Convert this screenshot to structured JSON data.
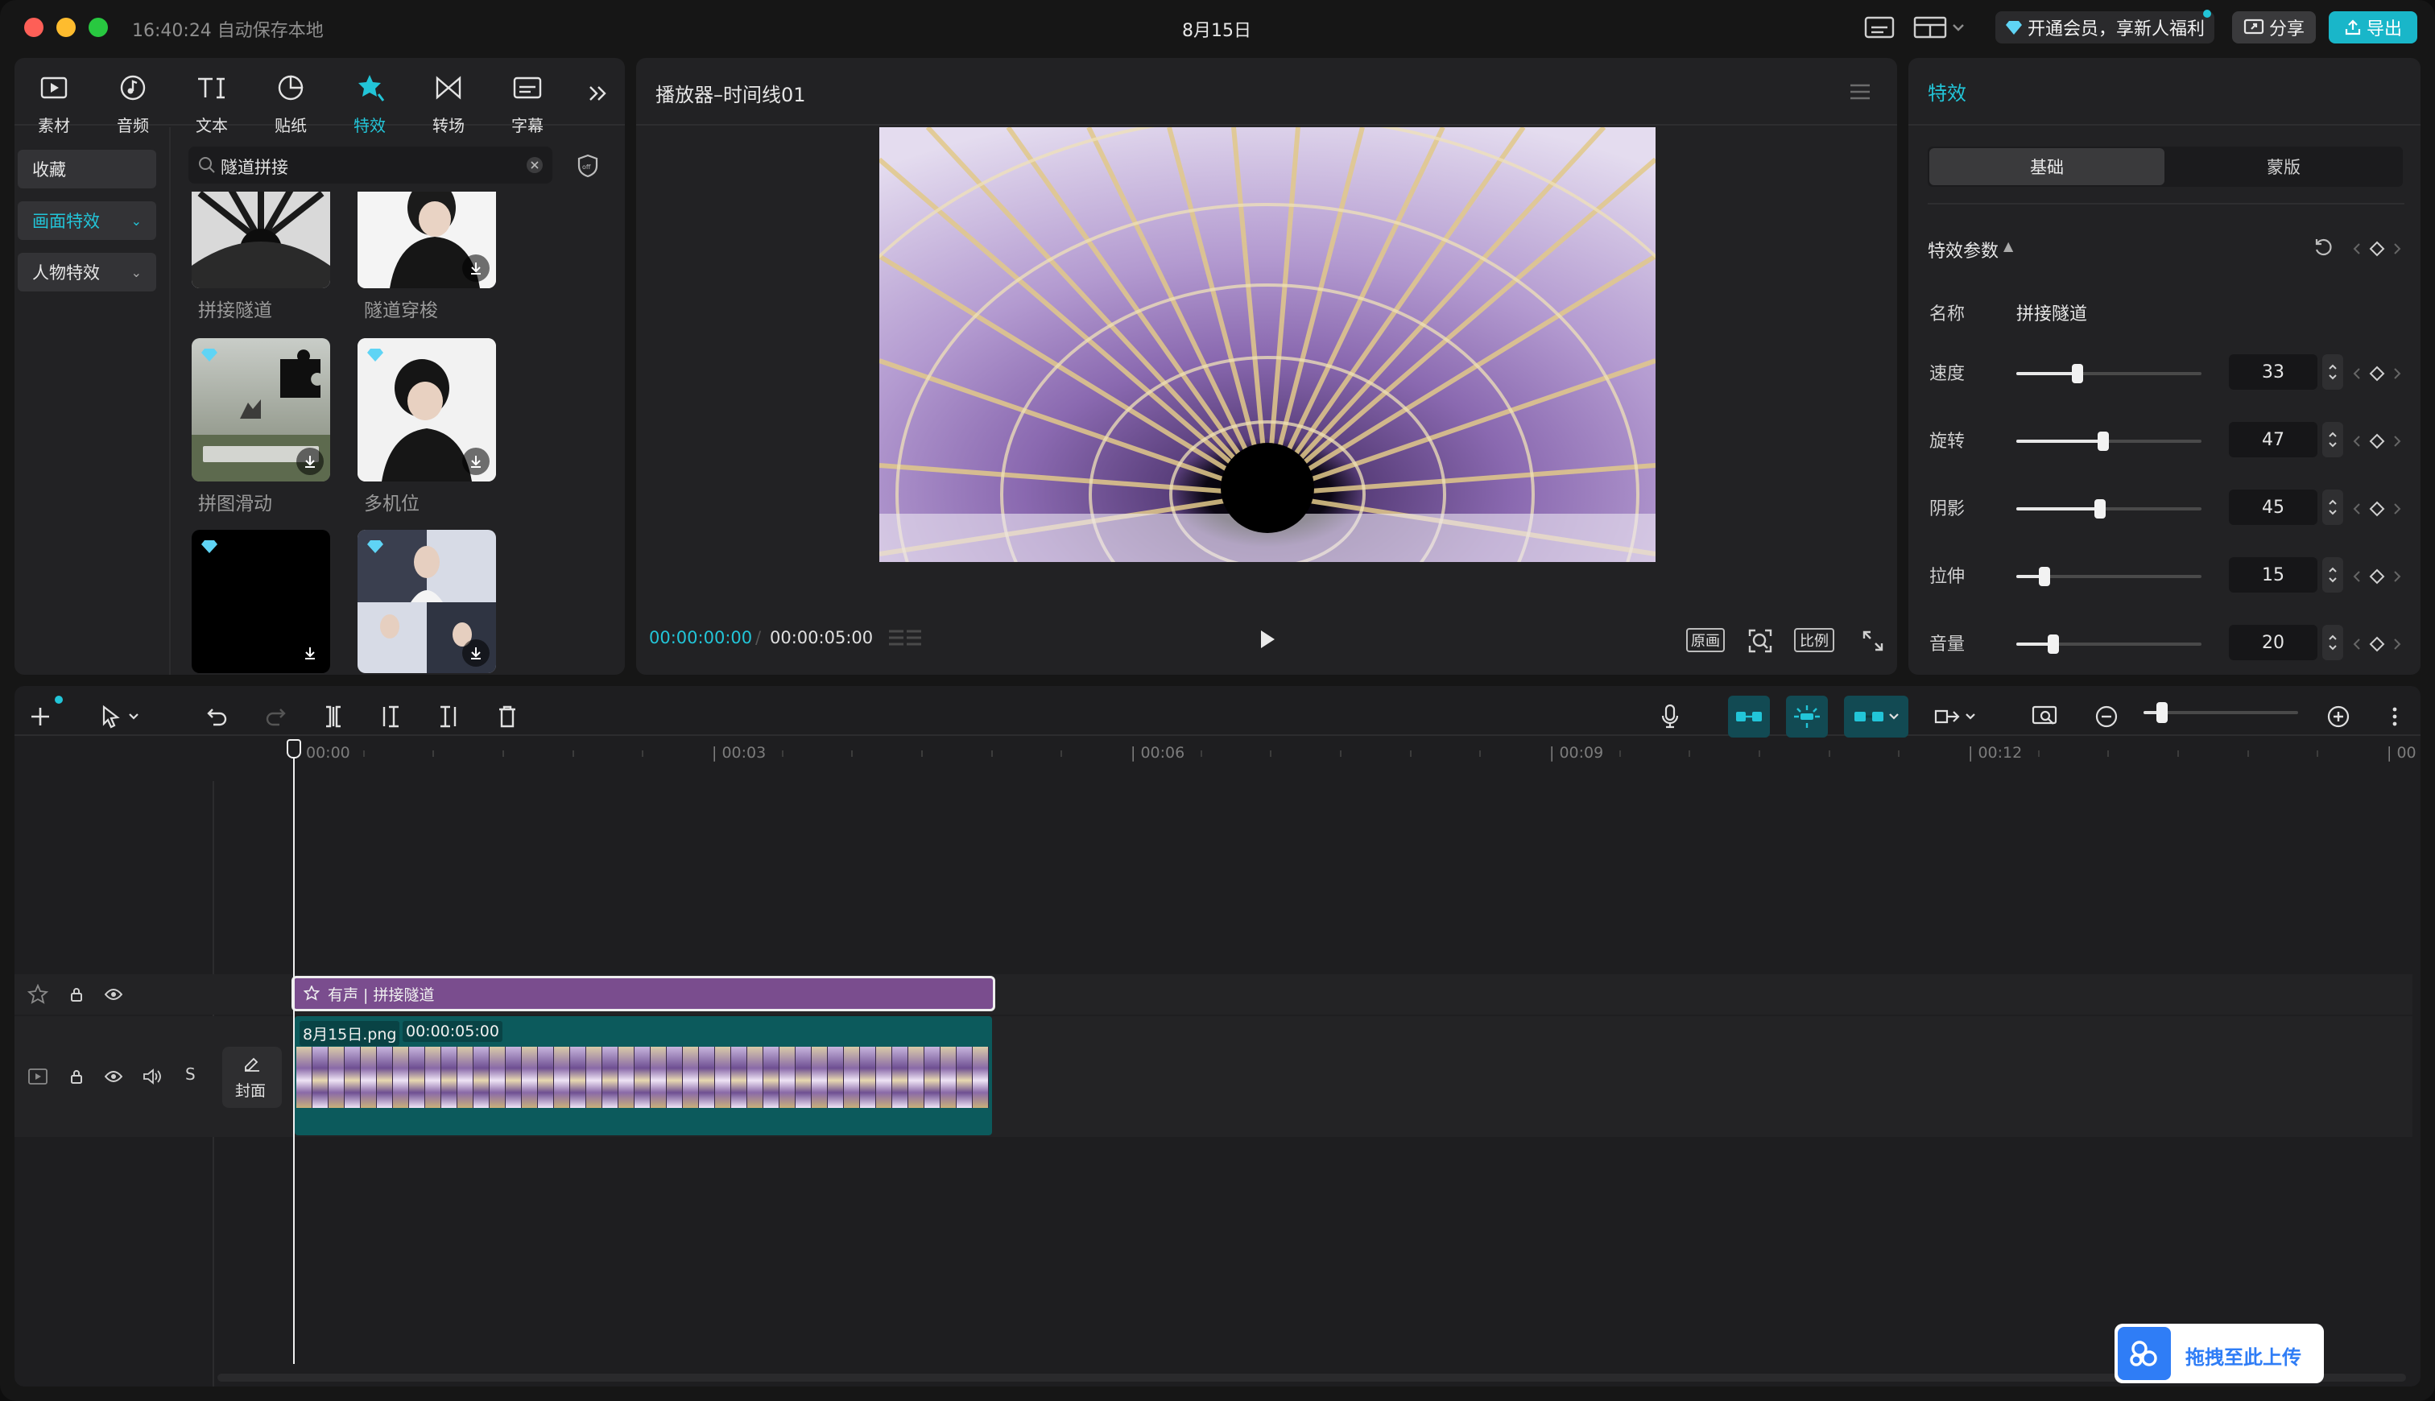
{
  "titlebar": {
    "time_status": "16:40:24 自动保存本地",
    "doc_title": "8月15日",
    "vip_text": "开通会员，享新人福利",
    "share_label": "分享",
    "export_label": "导出",
    "icons": [
      "subtitle-icon",
      "layout-icon",
      "diamond-icon",
      "share-icon",
      "export-icon"
    ]
  },
  "media_tabs": [
    {
      "label": "素材",
      "icon": "media-icon"
    },
    {
      "label": "音频",
      "icon": "audio-icon"
    },
    {
      "label": "文本",
      "icon": "text-icon"
    },
    {
      "label": "贴纸",
      "icon": "sticker-icon"
    },
    {
      "label": "特效",
      "icon": "effects-icon",
      "active": true
    },
    {
      "label": "转场",
      "icon": "transition-icon"
    },
    {
      "label": "字幕",
      "icon": "caption-icon"
    }
  ],
  "categories": [
    {
      "label": "收藏"
    },
    {
      "label": "画面特效",
      "selected": true
    },
    {
      "label": "人物特效"
    }
  ],
  "search": {
    "value": "隧道拼接"
  },
  "effects": [
    {
      "label": "拼接隧道"
    },
    {
      "label": "隧道穿梭"
    },
    {
      "label": "拼图滑动"
    },
    {
      "label": "多机位"
    },
    {
      "label": ""
    },
    {
      "label": ""
    }
  ],
  "player": {
    "title": "播放器–时间线01",
    "current_time": "00:00:00:00",
    "total_time": "00:00:05:00",
    "original_label": "原画",
    "ratio_label": "比例"
  },
  "inspector": {
    "title": "特效",
    "tabs": [
      "基础",
      "蒙版"
    ],
    "section_title": "特效参数",
    "name_label": "名称",
    "name_value": "拼接隧道",
    "params": [
      {
        "label": "速度",
        "value": 33,
        "level": 0.33
      },
      {
        "label": "旋转",
        "value": 47,
        "level": 0.47
      },
      {
        "label": "阴影",
        "value": 45,
        "level": 0.45
      },
      {
        "label": "拉伸",
        "value": 15,
        "level": 0.15
      },
      {
        "label": "音量",
        "value": 20,
        "level": 0.2
      }
    ]
  },
  "timeline": {
    "ruler_labels": [
      "00:00",
      "| 00:03",
      "| 00:06",
      "| 00:09",
      "| 00:12",
      "| 00"
    ],
    "effect_clip_label": "有声 | 拼接隧道",
    "video_clip_name": "8月15日.png",
    "video_clip_duration": "00:00:05:00",
    "cover_label": "封面",
    "track_s_label": "S",
    "upload_label": "拖拽至此上传"
  },
  "colors": {
    "accent": "#22c5d8",
    "effect_clip": "#7a4d8e",
    "video_clip": "#0c5a5c",
    "export_button": "#19b6c9"
  }
}
